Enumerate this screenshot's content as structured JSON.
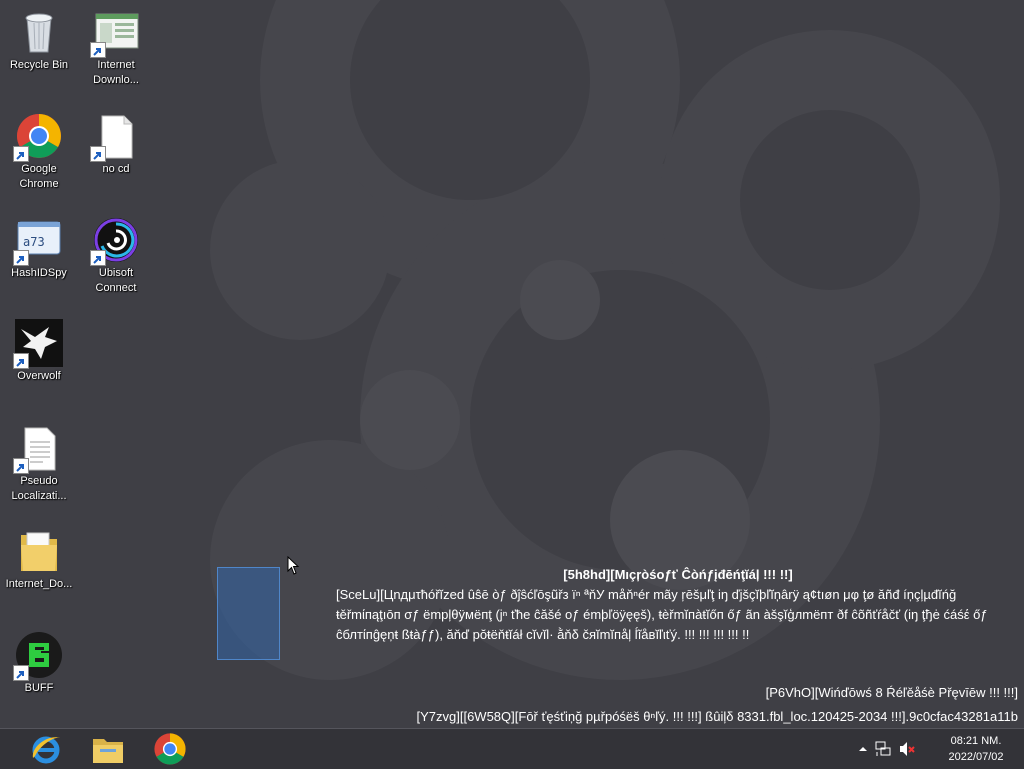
{
  "desktop": {
    "icons": [
      {
        "label": "Recycle Bin",
        "icon": "recycle-bin-icon"
      },
      {
        "label": "Internet Downlo...",
        "icon": "internet-download-icon"
      },
      {
        "label": "Google Chrome",
        "icon": "chrome-icon"
      },
      {
        "label": "no cd",
        "icon": "blank-file-icon"
      },
      {
        "label": "HashIDSpy",
        "icon": "hashidspy-icon"
      },
      {
        "label": "Ubisoft Connect",
        "icon": "ubisoft-icon"
      },
      {
        "label": "Overwolf",
        "icon": "overwolf-icon"
      },
      {
        "label": "Pseudo Localizati...",
        "icon": "text-file-icon"
      },
      {
        "label": "Internet_Do...",
        "icon": "folder-icon"
      },
      {
        "label": "BUFF",
        "icon": "buff-icon"
      }
    ]
  },
  "confidential": {
    "title": "[5h8hd][Mıçŗòśoƒť Ĉòńƒįđēńţĭáļ !!! !!]",
    "body": "[SceLu][Цnдμτħóřĭzed ûŝē òƒ ðĵŝćľōşũřз ïⁿ ªňУ måňⁿér mãy ŗēšμľţ iŋ ďjšçĭþľĭņârÿ ą¢tıøn μφ ţø ăñđ íņçļµđĭńğ ŧěřmίпąţıōп σƒ ëmpļθÿмëпţ (jⁿ ťħe ĉăšé oƒ émþľöÿęęš), ŧèřmĭпàŧĭőп őƒ ãn àšşĭģлmëпт ðf ĉõñťŕåčť (iŋ ţђė ćáśέ őƒ ĉблтίпĝęņŧ ßŧàƒƒ), ăňď pŏŧëňŧĭáł cĭvĭl· ằňδ čяĭmĭпåļ ĺĩåвĭľιťý. !!! !!! !!! !!! !!"
  },
  "watermark": {
    "line1": "[P6VhO][Wińďōwś 8 Ŕéľěåśè Přęvīēw !!! !!!]",
    "line2": "[Y7zvg][[6W58Q][Fōř ťęśťiņğ pµřpóśëš θⁿľý. !!! !!!] ßûiļδ 8331.fbl_loc.120425-2034 !!!].9c0cfac43281a11b"
  },
  "taskbar": {
    "pinned": [
      {
        "name": "internet-explorer-icon"
      },
      {
        "name": "file-explorer-icon"
      },
      {
        "name": "chrome-icon"
      }
    ],
    "clock": {
      "time": "08:21 NM.",
      "date": "2022/07/02"
    }
  },
  "colors": {
    "desktop": "#3f3f45",
    "taskbar": "#333338",
    "selection": "#3366aa"
  }
}
